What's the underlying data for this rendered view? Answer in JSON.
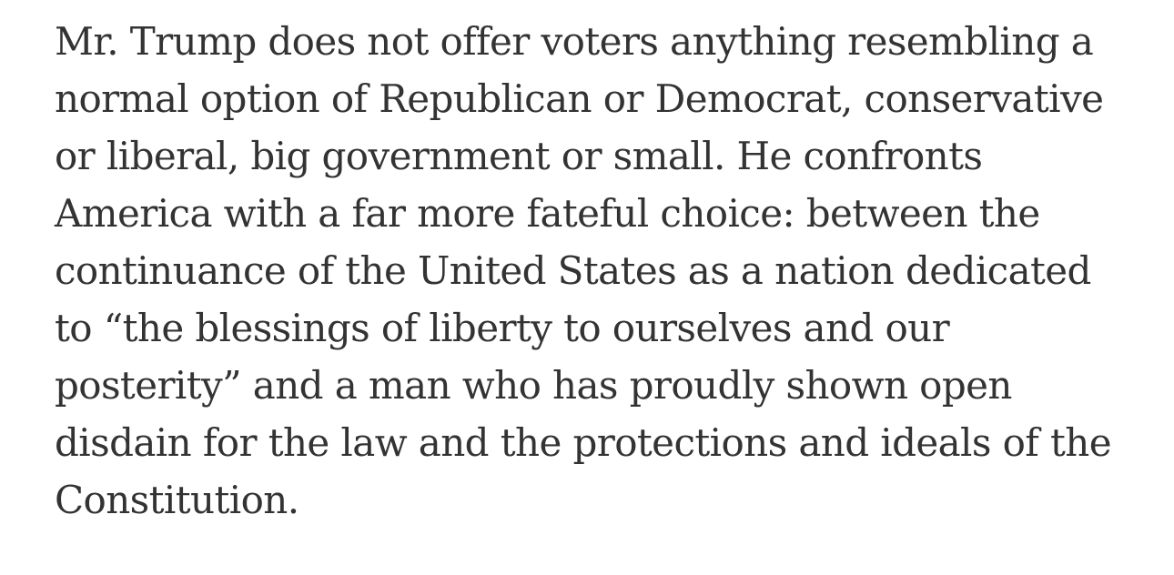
{
  "article": {
    "paragraph_lines": [
      "Mr. Trump does not offer voters anything resembling a",
      "normal option of Republican or Democrat, conservative",
      "or liberal, big government or small. He confronts",
      "America with a far more fateful choice: between the",
      "continuance of the United States as a nation dedicated",
      "to “the blessings of liberty to ourselves and our",
      "posterity” and a man who has proudly shown open",
      "disdain for the law and the protections and ideals of the",
      "Constitution."
    ]
  },
  "colors": {
    "text": "#333333",
    "background": "#ffffff"
  }
}
